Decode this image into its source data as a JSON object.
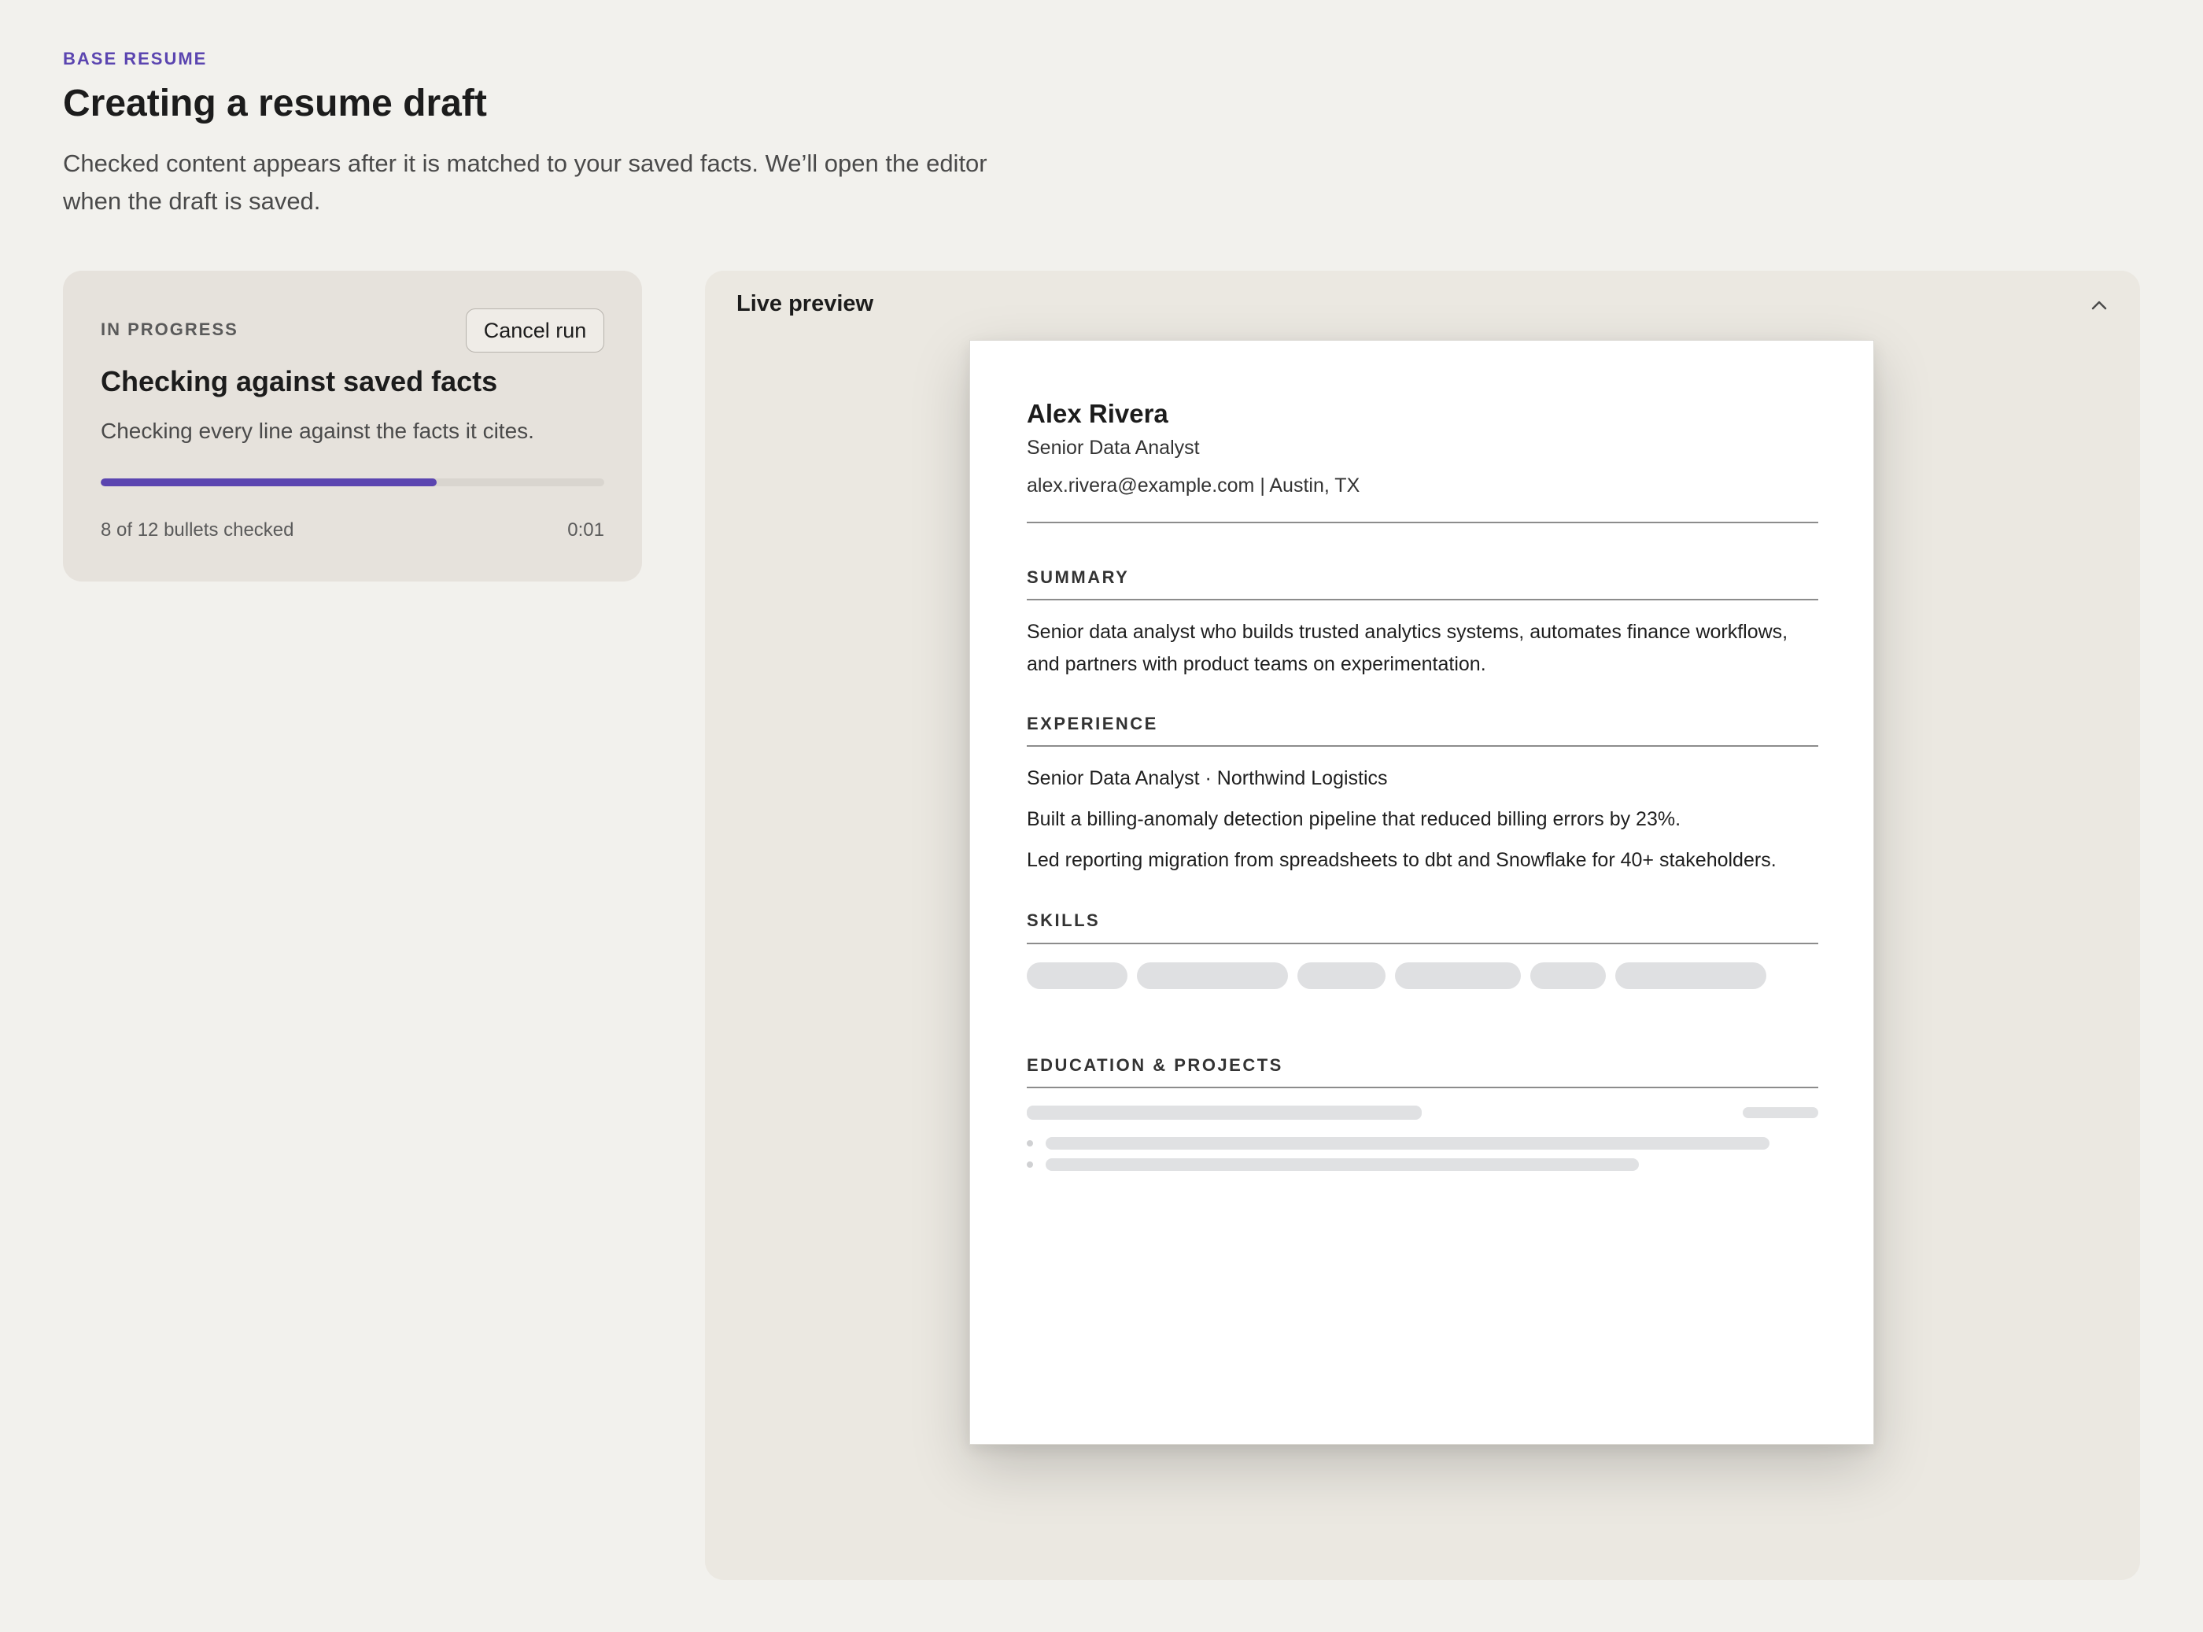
{
  "header": {
    "eyebrow": "BASE RESUME",
    "title": "Creating a resume draft",
    "description": "Checked content appears after it is matched to your saved facts. We’ll open the editor when the draft is saved."
  },
  "progress": {
    "status": "IN PROGRESS",
    "cancel_label": "Cancel run",
    "step_title": "Checking against saved facts",
    "step_description": "Checking every line against the facts it cites.",
    "checked": 8,
    "total": 12,
    "count_label": "8 of 12 bullets checked",
    "elapsed": "0:01",
    "accent_color": "#5b45b0"
  },
  "preview": {
    "title": "Live preview",
    "collapse_icon": "chevron-up-icon",
    "resume": {
      "name": "Alex Rivera",
      "role": "Senior Data Analyst",
      "contact": "alex.rivera@example.com | Austin, TX",
      "summary_heading": "SUMMARY",
      "summary": "Senior data analyst who builds trusted analytics systems, automates finance workflows, and partners with product teams on experimentation.",
      "experience_heading": "EXPERIENCE",
      "experience": {
        "position": "Senior Data Analyst · Northwind Logistics",
        "bullets": [
          "Built a billing-anomaly detection pipeline that reduced billing errors by 23%.",
          "Led reporting migration from spreadsheets to dbt and Snowflake for 40+ stakeholders."
        ]
      },
      "skills_heading": "SKILLS",
      "education_heading": "EDUCATION & PROJECTS"
    }
  }
}
